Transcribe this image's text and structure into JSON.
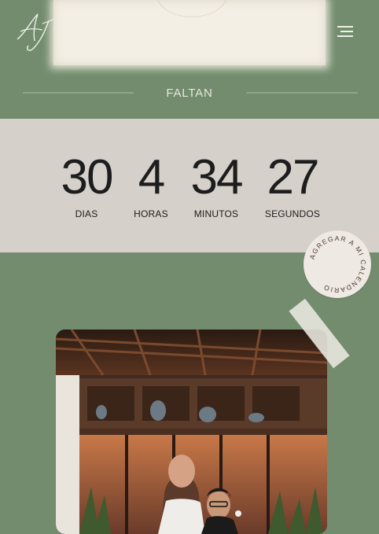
{
  "header": {
    "logo_text": "AJ",
    "logo_icon": "monogram-logo",
    "menu_icon": "hamburger-menu-icon"
  },
  "faltan": {
    "label": "FALTAN"
  },
  "countdown": {
    "days": {
      "value": "30",
      "label": "DIAS"
    },
    "hours": {
      "value": "4",
      "label": "HORAS"
    },
    "minutes": {
      "value": "34",
      "label": "MINUTOS"
    },
    "seconds": {
      "value": "27",
      "label": "SEGUNDOS"
    }
  },
  "calendar_badge": {
    "text": "AGREGAR A MI CALENDARIO"
  },
  "photo": {
    "subject": "wedding-couple-photo"
  },
  "colors": {
    "green": "#728c6d",
    "countdown_bg": "#d5d0ca",
    "badge_bg": "#efe9e3",
    "text_dark": "#1d1d1d",
    "text_light": "#e6e7de"
  }
}
